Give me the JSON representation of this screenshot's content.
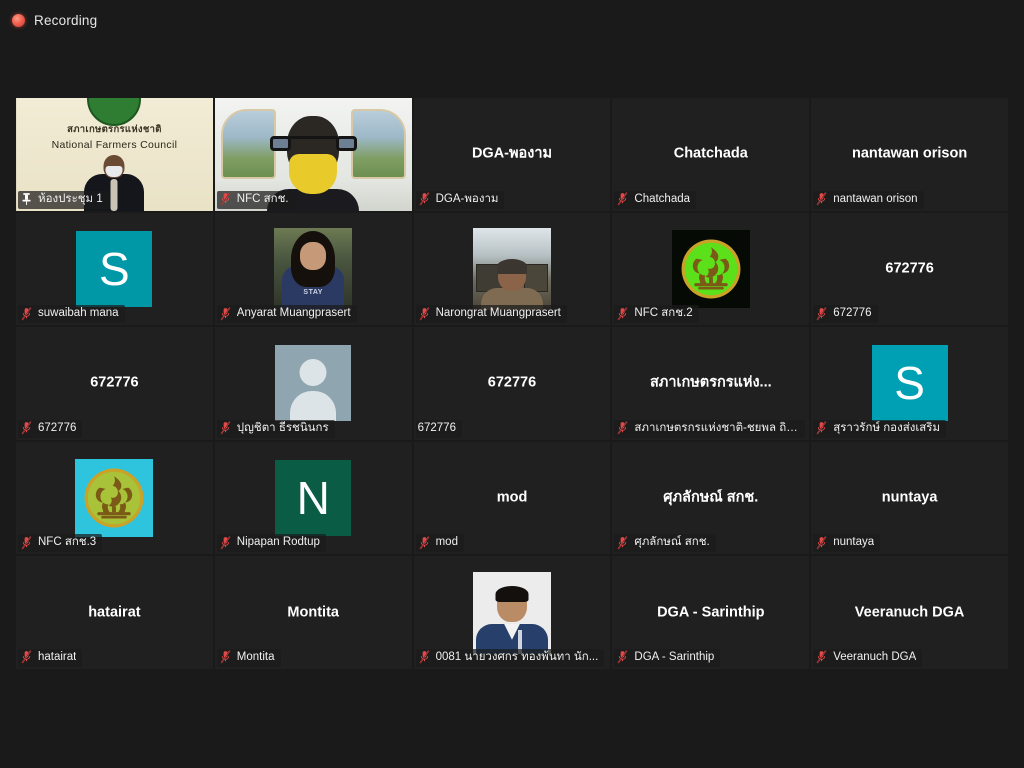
{
  "window": {
    "background_color": "#1a1a1a",
    "tile_background_color": "#202020",
    "active_speaker_color": "#c9e265",
    "muted_icon_color": "#e04a4a"
  },
  "recording": {
    "label": "Recording",
    "icon": "recording-dot-icon",
    "dot_color": "#f2604f"
  },
  "gallery": {
    "columns": 5,
    "rows": 5,
    "tiles": [
      {
        "name": "ห้องประชุม 1",
        "label": "ห้องประชุม 1",
        "status_icon": "pin-icon",
        "muted": false,
        "pinned": true,
        "video": true,
        "video_kind": "nfc-meeting-room",
        "highlight": "bright",
        "overlay_title_th": "สภาเกษตรกรแห่งชาติ",
        "overlay_title_en": "National Farmers Council",
        "center_name": ""
      },
      {
        "name": "NFC สกช.",
        "label": "NFC สกช.",
        "status_icon": "mic-muted-icon",
        "muted": true,
        "pinned": false,
        "video": true,
        "video_kind": "person-yellow-mask",
        "highlight": "dim",
        "center_name": ""
      },
      {
        "name": "DGA-พองาม",
        "label": "DGA-พองาม",
        "status_icon": "mic-muted-icon",
        "muted": true,
        "video": false,
        "avatar": "none",
        "center_name": "DGA-พองาม"
      },
      {
        "name": "Chatchada",
        "label": "Chatchada",
        "status_icon": "mic-muted-icon",
        "muted": true,
        "video": false,
        "avatar": "none",
        "center_name": "Chatchada"
      },
      {
        "name": "nantawan orison",
        "label": "nantawan orison",
        "status_icon": "mic-muted-icon",
        "muted": true,
        "video": false,
        "avatar": "none",
        "center_name": "nantawan orison"
      },
      {
        "name": "suwaibah mana",
        "label": "suwaibah mana",
        "status_icon": "mic-muted-icon",
        "muted": true,
        "video": false,
        "avatar": "letter",
        "avatar_letter": "S",
        "avatar_color": "#0097a7",
        "center_name": ""
      },
      {
        "name": "Anyarat Muangprasert",
        "label": "Anyarat Muangprasert",
        "status_icon": "mic-muted-icon",
        "muted": true,
        "video": false,
        "avatar": "photo",
        "photo_kind": "anyarat",
        "center_name": ""
      },
      {
        "name": "Narongrat Muangprasert",
        "label": "Narongrat Muangprasert",
        "status_icon": "mic-muted-icon",
        "muted": true,
        "video": false,
        "avatar": "photo",
        "photo_kind": "narongrat",
        "center_name": ""
      },
      {
        "name": "NFC สกช.2",
        "label": "NFC สกช.2",
        "status_icon": "mic-muted-icon",
        "muted": true,
        "video": false,
        "avatar": "emblem",
        "emblem_bg": "#060a05",
        "emblem_disc": "#5ce019",
        "center_name": ""
      },
      {
        "name": "672776",
        "label": "672776",
        "status_icon": "mic-muted-icon",
        "muted": true,
        "video": false,
        "avatar": "none",
        "center_name": "672776"
      },
      {
        "name": "672776",
        "label": "672776",
        "status_icon": "mic-muted-icon",
        "muted": true,
        "video": false,
        "avatar": "none",
        "center_name": "672776"
      },
      {
        "name": "ปุญชิตา ธีรชนินกร",
        "label": "ปุญชิตา ธีรชนินกร",
        "status_icon": "mic-muted-icon",
        "muted": true,
        "video": false,
        "avatar": "generic",
        "center_name": ""
      },
      {
        "name": "672776",
        "label": "672776",
        "status_icon": "none",
        "muted": false,
        "video": false,
        "avatar": "none",
        "center_name": "672776"
      },
      {
        "name": "สภาเกษตรกรแห่งชาติ-ชยพล ถิลา",
        "label": "สภาเกษตรกรแห่งชาติ-ชยพล ถิลา",
        "status_icon": "mic-muted-icon",
        "muted": true,
        "video": false,
        "avatar": "none",
        "center_name": "สภาเกษตรกรแห่ง..."
      },
      {
        "name": "สุราวรักษ์ กองส่งเสริม",
        "label": "สุราวรักษ์ กองส่งเสริม",
        "status_icon": "mic-muted-icon",
        "muted": true,
        "video": false,
        "avatar": "letter",
        "avatar_letter": "S",
        "avatar_color": "#00a0b4",
        "center_name": ""
      },
      {
        "name": "NFC สกช.3",
        "label": "NFC สกช.3",
        "status_icon": "mic-muted-icon",
        "muted": true,
        "video": false,
        "avatar": "emblem",
        "emblem_bg": "#2ec4dd",
        "emblem_disc": "#a8c23a",
        "center_name": ""
      },
      {
        "name": "Nipapan Rodtup",
        "label": "Nipapan Rodtup",
        "status_icon": "mic-muted-icon",
        "muted": true,
        "video": false,
        "avatar": "letter",
        "avatar_letter": "N",
        "avatar_color": "#0b5c45",
        "center_name": ""
      },
      {
        "name": "mod",
        "label": "mod",
        "status_icon": "mic-muted-icon",
        "muted": true,
        "video": false,
        "avatar": "none",
        "center_name": "mod"
      },
      {
        "name": "ศุภลักษณ์ สกช.",
        "label": "ศุภลักษณ์ สกช.",
        "status_icon": "mic-muted-icon",
        "muted": true,
        "video": false,
        "avatar": "none",
        "center_name": "ศุภลักษณ์ สกช."
      },
      {
        "name": "nuntaya",
        "label": "nuntaya",
        "status_icon": "mic-muted-icon",
        "muted": true,
        "video": false,
        "avatar": "none",
        "center_name": "nuntaya"
      },
      {
        "name": "hatairat",
        "label": "hatairat",
        "status_icon": "mic-muted-icon",
        "muted": true,
        "video": false,
        "avatar": "none",
        "center_name": "hatairat"
      },
      {
        "name": "Montita",
        "label": "Montita",
        "status_icon": "mic-muted-icon",
        "muted": true,
        "video": false,
        "avatar": "none",
        "center_name": "Montita"
      },
      {
        "name": "0081 นายวงศกร ทองพ้นทา นัก...",
        "label": "0081 นายวงศกร ทองพ้นทา นัก...",
        "status_icon": "mic-muted-icon",
        "muted": true,
        "video": false,
        "avatar": "photo",
        "photo_kind": "person0081",
        "center_name": ""
      },
      {
        "name": "DGA - Sarinthip",
        "label": "DGA - Sarinthip",
        "status_icon": "mic-muted-icon",
        "muted": true,
        "video": false,
        "avatar": "none",
        "center_name": "DGA - Sarinthip"
      },
      {
        "name": "Veeranuch DGA",
        "label": "Veeranuch DGA",
        "status_icon": "mic-muted-icon",
        "muted": true,
        "video": false,
        "avatar": "none",
        "center_name": "Veeranuch DGA"
      }
    ]
  }
}
